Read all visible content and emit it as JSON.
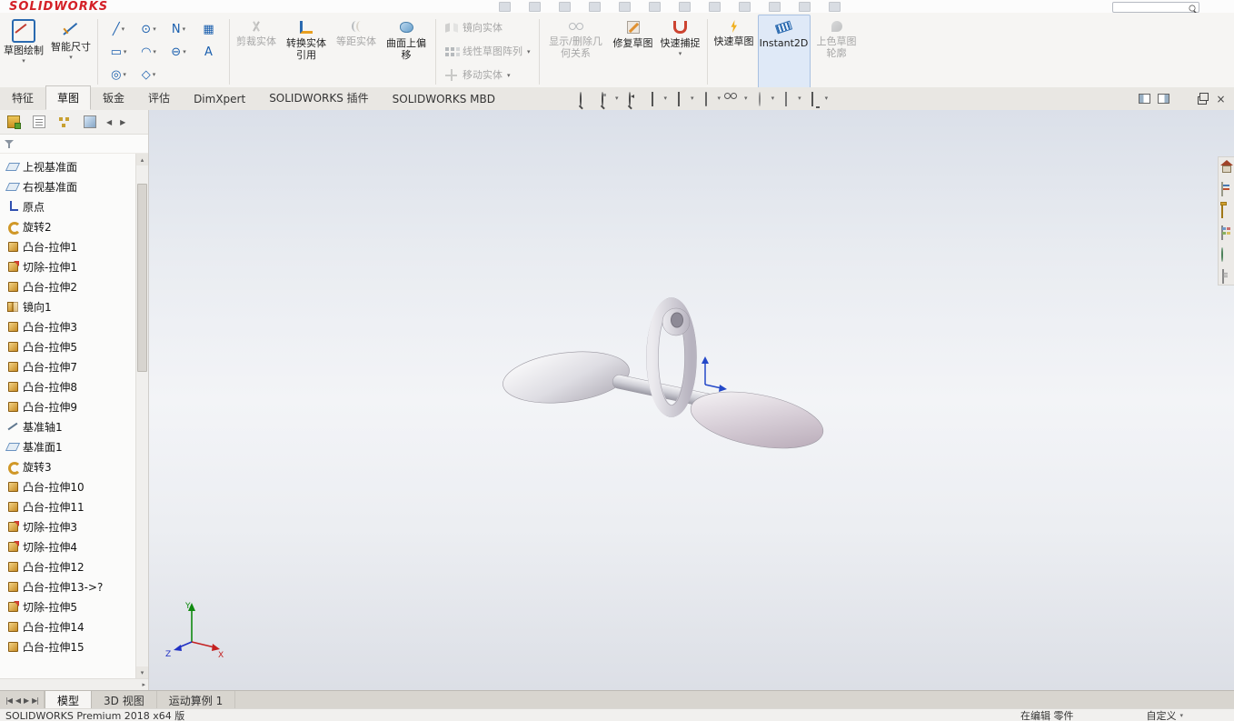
{
  "menubar": {
    "logo": "SOLIDWORKS",
    "icons": [
      {},
      {},
      {},
      {},
      {},
      {},
      {},
      {},
      {},
      {},
      {},
      {}
    ]
  },
  "ribbon": {
    "large": {
      "sketch": {
        "label": "草图绘制",
        "state": ""
      },
      "smart_dimension": {
        "label": "智能尺寸",
        "state": ""
      }
    },
    "sketch_tools": [
      {
        "glyph": "╱",
        "dd": "has-dd",
        "name": "line-tool-button"
      },
      {
        "glyph": "⊙",
        "dd": "has-dd",
        "name": "circle-tool-button"
      },
      {
        "glyph": "N",
        "dd": "has-dd",
        "name": "spline-tool-button"
      },
      {
        "glyph": "▦",
        "dd": "",
        "name": "sketch-picture-tool-button"
      },
      {
        "glyph": "▭",
        "dd": "has-dd",
        "name": "rectangle-tool-button"
      },
      {
        "glyph": "◠",
        "dd": "has-dd",
        "name": "arc-tool-button"
      },
      {
        "glyph": "⊖",
        "dd": "has-dd",
        "name": "ellipse-tool-button"
      },
      {
        "glyph": "A",
        "dd": "",
        "name": "sketch-text-tool-button"
      },
      {
        "glyph": "◎",
        "dd": "has-dd",
        "name": "slot-tool-button"
      },
      {
        "glyph": "◇",
        "dd": "has-dd",
        "name": "polygon-tool-button"
      }
    ],
    "buttons": {
      "trim": {
        "label": "剪裁实体",
        "state": "disabled"
      },
      "convert": {
        "label": "转换实体引用",
        "state": ""
      },
      "offset": {
        "label": "等距实体",
        "state": "disabled"
      },
      "surface_offset": {
        "label": "曲面上偏移",
        "state": ""
      },
      "mirror": {
        "label": "镜向实体",
        "state": "disabled"
      },
      "linear_pattern": {
        "label": "线性草图阵列",
        "state": "disabled"
      },
      "move": {
        "label": "移动实体",
        "state": "disabled"
      },
      "display_relations": {
        "label": "显示/删除几何关系",
        "state": "disabled"
      },
      "repair": {
        "label": "修复草图",
        "state": ""
      },
      "quick_snaps": {
        "label": "快速捕捉",
        "state": ""
      },
      "rapid_sketch": {
        "label": "快速草图",
        "state": ""
      },
      "instant2d": {
        "label": "Instant2D",
        "state": "active"
      },
      "shaded_contours": {
        "label": "上色草图轮廓",
        "state": "disabled"
      }
    },
    "tabs": [
      {
        "label": "特征",
        "state": ""
      },
      {
        "label": "草图",
        "state": "active"
      },
      {
        "label": "钣金",
        "state": ""
      },
      {
        "label": "评估",
        "state": ""
      },
      {
        "label": "DimXpert",
        "state": ""
      },
      {
        "label": "SOLIDWORKS 插件",
        "state": ""
      },
      {
        "label": "SOLIDWORKS MBD",
        "state": ""
      }
    ]
  },
  "headsup": [
    {
      "icon": "hu-mag",
      "dd": "",
      "name": "zoom-to-fit-button"
    },
    {
      "icon": "hu-magbox",
      "dd": "has-dd",
      "name": "zoom-to-area-button"
    },
    {
      "icon": "hu-maglast",
      "dd": "",
      "name": "previous-view-button"
    },
    {
      "icon": "hu-section",
      "dd": "has-dd",
      "name": "section-view-button"
    },
    {
      "icon": "hu-cube",
      "dd": "has-dd",
      "name": "view-orientation-button"
    },
    {
      "icon": "hu-dstyle",
      "dd": "has-dd",
      "name": "display-style-button"
    },
    {
      "icon": "hu-eye",
      "dd": "has-dd",
      "name": "hide-show-items-button"
    },
    {
      "icon": "hu-ball",
      "dd": "has-dd",
      "name": "edit-appearance-button"
    },
    {
      "icon": "hu-scene",
      "dd": "has-dd",
      "name": "apply-scene-button"
    },
    {
      "icon": "hu-monitor",
      "dd": "has-dd",
      "name": "view-settings-button"
    }
  ],
  "window_buttons": [
    {
      "icon": "wb-pleft",
      "name": "collapse-left-pane-button"
    },
    {
      "icon": "wb-pright",
      "name": "collapse-right-pane-button"
    },
    {
      "icon": "wb-min",
      "name": "minimize-viewport-button"
    },
    {
      "icon": "wb-rest",
      "name": "restore-viewport-button"
    },
    {
      "icon": "wb-close",
      "name": "close-viewport-button"
    }
  ],
  "panel": {
    "tabs": [
      {
        "icon": "pt-fm",
        "name": "featuremanager-tree-tab"
      },
      {
        "icon": "pt-pm",
        "name": "propertymanager-tab"
      },
      {
        "icon": "pt-cm",
        "name": "configurationmanager-tab"
      },
      {
        "icon": "pt-dm",
        "name": "displaymanager-tab"
      }
    ],
    "tree": [
      {
        "label": "上视基准面",
        "icon": "t-plane"
      },
      {
        "label": "右视基准面",
        "icon": "t-plane"
      },
      {
        "label": "原点",
        "icon": "t-origin"
      },
      {
        "label": "旋转2",
        "icon": "t-revolve"
      },
      {
        "label": "凸台-拉伸1",
        "icon": "t-boss"
      },
      {
        "label": "切除-拉伸1",
        "icon": "t-cut"
      },
      {
        "label": "凸台-拉伸2",
        "icon": "t-boss"
      },
      {
        "label": "镜向1",
        "icon": "t-mirror"
      },
      {
        "label": "凸台-拉伸3",
        "icon": "t-boss"
      },
      {
        "label": "凸台-拉伸5",
        "icon": "t-boss"
      },
      {
        "label": "凸台-拉伸7",
        "icon": "t-boss"
      },
      {
        "label": "凸台-拉伸8",
        "icon": "t-boss"
      },
      {
        "label": "凸台-拉伸9",
        "icon": "t-boss"
      },
      {
        "label": "基准轴1",
        "icon": "t-axis"
      },
      {
        "label": "基准面1",
        "icon": "t-plane"
      },
      {
        "label": "旋转3",
        "icon": "t-revolve"
      },
      {
        "label": "凸台-拉伸10",
        "icon": "t-boss"
      },
      {
        "label": "凸台-拉伸11",
        "icon": "t-boss"
      },
      {
        "label": "切除-拉伸3",
        "icon": "t-cut"
      },
      {
        "label": "切除-拉伸4",
        "icon": "t-cut"
      },
      {
        "label": "凸台-拉伸12",
        "icon": "t-boss"
      },
      {
        "label": "凸台-拉伸13->?",
        "icon": "t-boss"
      },
      {
        "label": "切除-拉伸5",
        "icon": "t-cut"
      },
      {
        "label": "凸台-拉伸14",
        "icon": "t-boss"
      },
      {
        "label": "凸台-拉伸15",
        "icon": "t-boss"
      }
    ]
  },
  "taskpane": [
    {
      "icon": "tp-home",
      "name": "home-taskpane-tab"
    },
    {
      "icon": "tp-lib",
      "name": "design-library-tab"
    },
    {
      "icon": "tp-files",
      "name": "file-explorer-tab"
    },
    {
      "icon": "tp-palette",
      "name": "view-palette-tab"
    },
    {
      "icon": "tp-appear",
      "name": "appearances-scenes-tab"
    },
    {
      "icon": "tp-props",
      "name": "custom-properties-tab"
    }
  ],
  "viewport": {
    "triad": {
      "x": "X",
      "y": "Y",
      "z": "Z"
    }
  },
  "bottom": {
    "nav": [
      {
        "glyph": "|◀"
      },
      {
        "glyph": "◀"
      },
      {
        "glyph": "▶"
      },
      {
        "glyph": "▶|"
      }
    ],
    "tabs": [
      {
        "label": "模型",
        "state": "active"
      },
      {
        "label": "3D 视图",
        "state": ""
      },
      {
        "label": "运动算例 1",
        "state": ""
      }
    ]
  },
  "status": {
    "left": "SOLIDWORKS Premium 2018 x64 版",
    "editing": "在编辑 零件",
    "custom": "自定义"
  }
}
